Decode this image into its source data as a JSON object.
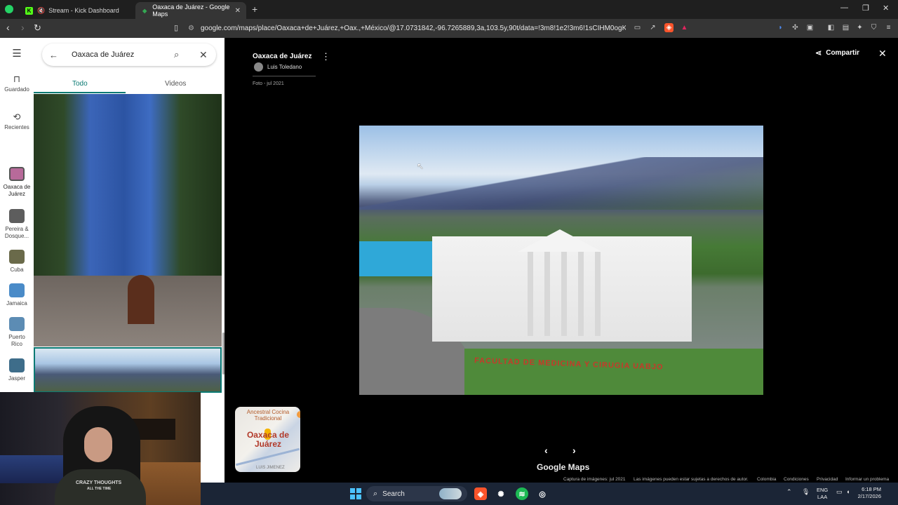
{
  "browser": {
    "tabs": [
      {
        "title": "Stream - Kick Dashboard",
        "active": false
      },
      {
        "title": "Oaxaca de Juárez - Google Maps",
        "active": true
      }
    ],
    "url": "google.com/maps/place/Oaxaca+de+Juárez,+Oax.,+México/@17.0731842,-96.7265889,3a,103.5y,90t/data=!3m8!1e2!3m6!1sCIHM0ogKEICAgl..."
  },
  "maps": {
    "rail": [
      {
        "label": "Guardado",
        "icon": "bookmark-icon"
      },
      {
        "label": "Recientes",
        "icon": "history-icon"
      },
      {
        "label": "Oaxaca de Juárez",
        "icon": "place-thumbnail"
      },
      {
        "label": "Pereira & Dosque...",
        "icon": "place-thumbnail"
      },
      {
        "label": "Cuba",
        "icon": "place-thumbnail"
      },
      {
        "label": "Jamaica",
        "icon": "place-thumbnail"
      },
      {
        "label": "Puerto Rico",
        "icon": "place-thumbnail"
      },
      {
        "label": "Jasper",
        "icon": "place-thumbnail"
      }
    ],
    "search": {
      "query": "Oaxaca de Juárez"
    },
    "tabs": [
      {
        "label": "Todo",
        "active": true
      },
      {
        "label": "Videos",
        "active": false
      }
    ]
  },
  "viewer": {
    "title": "Oaxaca de Juárez",
    "author": "Luis Toledano",
    "date": "Foto - jul 2021",
    "share_label": "Compartir",
    "photo_sign": "FACULTAD DE MEDICINA Y CIRUGIA UABJO",
    "minimap": {
      "poi": "Ancestral Cocina Tradicional",
      "place": "Oaxaca de Juárez",
      "street": "LUIS JIMENEZ"
    },
    "logo": "Google Maps",
    "footer": [
      "Captura de imágenes: jul 2021",
      "Las imágenes pueden estar sujetas a derechos de autor.",
      "Colombia",
      "Condiciones",
      "Privacidad",
      "Informar un problema"
    ]
  },
  "webcam": {
    "shirt_text_1": "CRAZY THOUGHTS",
    "shirt_text_2": "ALL THE TIME"
  },
  "taskbar": {
    "search_label": "Search",
    "lang_1": "ENG",
    "lang_2": "LAA",
    "time": "6:18 PM",
    "date": "2/17/2026"
  },
  "colors": {
    "accent": "#0a7a73",
    "chrome_dark": "#1f1f1f",
    "taskbar": "#1b2536"
  }
}
